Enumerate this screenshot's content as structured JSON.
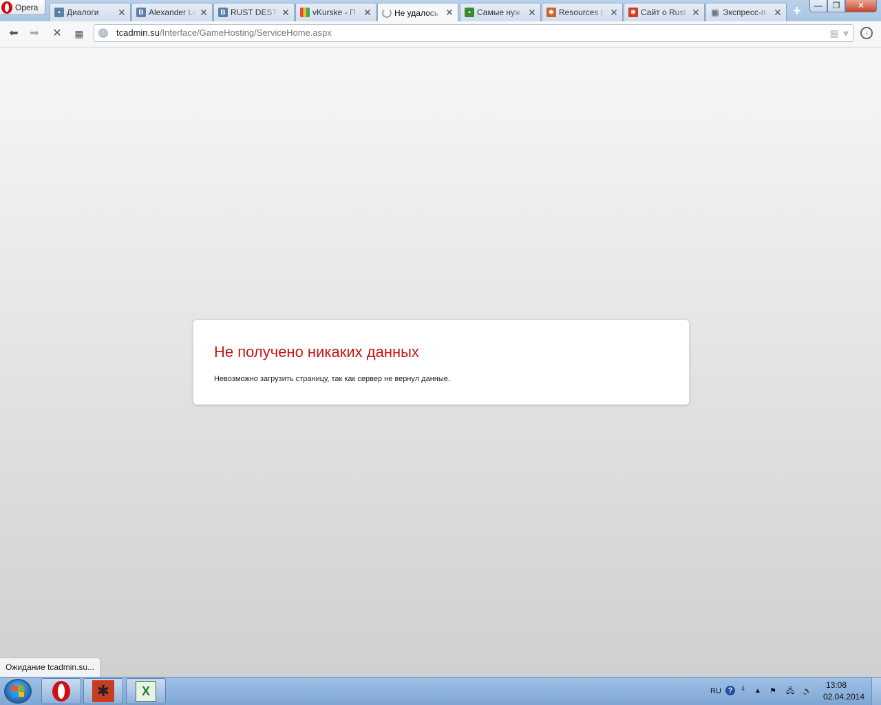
{
  "browser": {
    "menu_label": "Opera",
    "tabs": [
      {
        "title": "Диалоги",
        "favicon": "vk-dialogs-icon",
        "color": "#5b7fa6"
      },
      {
        "title": "Alexander Le",
        "favicon": "vk-icon",
        "color": "#5b7fa6"
      },
      {
        "title": "RUST DESTR",
        "favicon": "vk-icon",
        "color": "#5b7fa6"
      },
      {
        "title": "vKurske - П",
        "favicon": "vkurske-icon",
        "color": "#7aa33a"
      },
      {
        "title": "Не удалось",
        "favicon": "loading-spinner-icon",
        "color": "#999999"
      },
      {
        "title": "Самые нуж",
        "favicon": "minecraft-creeper-icon",
        "color": "#3d8b2f"
      },
      {
        "title": "Resources |",
        "favicon": "rust-resource-icon",
        "color": "#c9632a"
      },
      {
        "title": "Сайт о Rust",
        "favicon": "rust-site-icon",
        "color": "#d33a1f"
      },
      {
        "title": "Экспресс-п",
        "favicon": "speed-dial-icon",
        "color": "#555555"
      }
    ],
    "active_tab_index": 4,
    "url_host": "tcadmin.su",
    "url_path": "/Interface/GameHosting/ServiceHome.aspx"
  },
  "error": {
    "title": "Не получено никаких данных",
    "description": "Невозможно загрузить страницу, так как сервер не вернул данные."
  },
  "status_bar": {
    "text": "Ожидание tcadmin.su..."
  },
  "taskbar": {
    "apps": [
      "opera-icon",
      "rust-game-icon",
      "excel-icon"
    ],
    "lang": "RU",
    "time": "13:08",
    "date": "02.04.2014"
  },
  "colors": {
    "error_title": "#c41616",
    "tabstrip": "#b9d1ea"
  }
}
